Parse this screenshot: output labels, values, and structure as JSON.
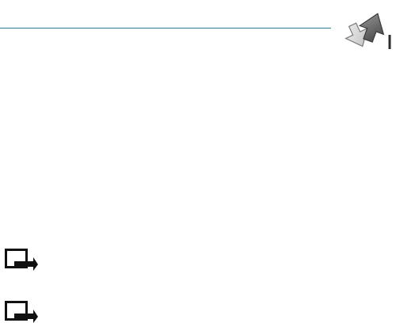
{
  "page": {
    "header_icon": "network-transfer-arrows-icon",
    "header_rule_color": "#2b7f95",
    "notes": [
      {
        "icon": "note-icon"
      },
      {
        "icon": "note-icon"
      }
    ]
  }
}
